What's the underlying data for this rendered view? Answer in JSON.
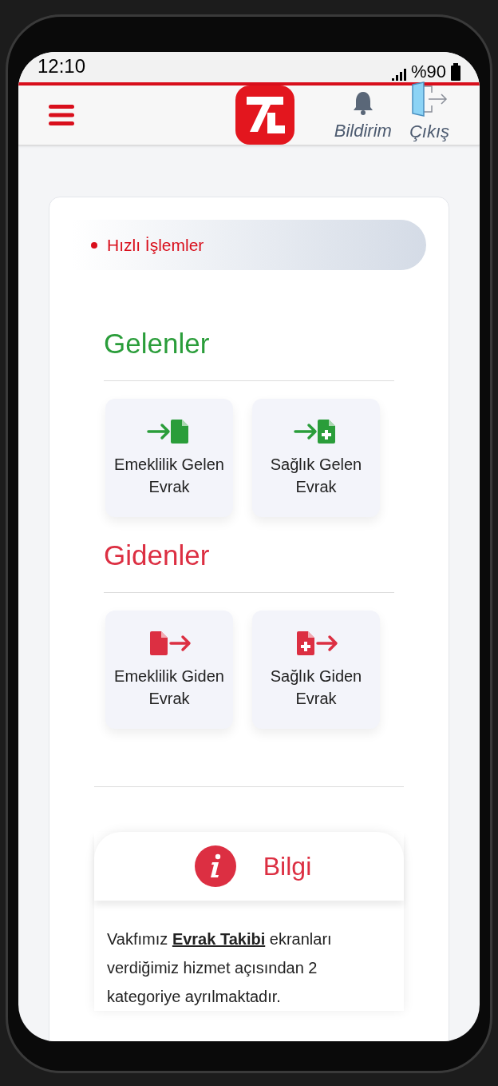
{
  "status_bar": {
    "time": "12:10",
    "battery": "%90"
  },
  "header": {
    "notifications_label": "Bildirim",
    "logout_label": "Çıkış"
  },
  "quick_actions": {
    "title": "Hızlı İşlemler"
  },
  "groups": [
    {
      "title": "Gelenler",
      "kind": "incoming",
      "items": [
        {
          "label": "Emeklilik Gelen Evrak",
          "kind": "plain"
        },
        {
          "label": "Sağlık Gelen Evrak",
          "kind": "health"
        }
      ]
    },
    {
      "title": "Gidenler",
      "kind": "outgoing",
      "items": [
        {
          "label": "Emeklilik Giden Evrak",
          "kind": "plain"
        },
        {
          "label": "Sağlık Giden Evrak",
          "kind": "health"
        }
      ]
    }
  ],
  "info": {
    "title": "Bilgi",
    "text_before": "Vakfımız",
    "link": "Evrak Takibi",
    "text_after": "ekranları verdiğimiz hizmet açısından 2 kategoriye ayrılmaktadır."
  }
}
